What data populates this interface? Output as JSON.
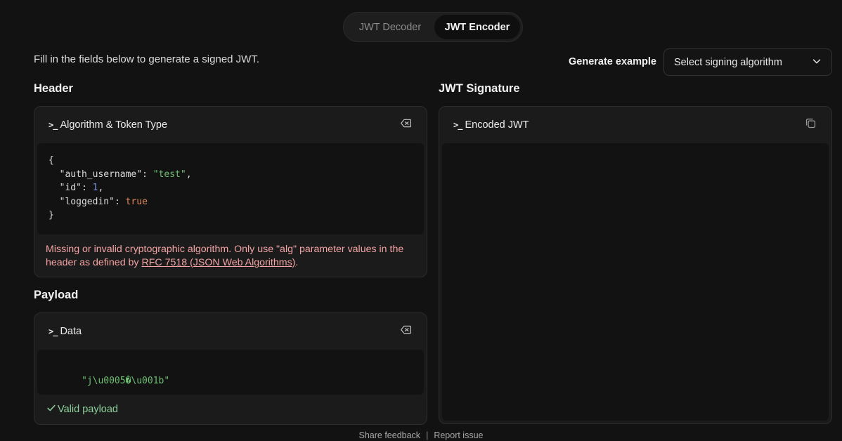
{
  "mode_toggle": {
    "decoder_label": "JWT Decoder",
    "encoder_label": "JWT Encoder",
    "active": "encoder"
  },
  "intro": "Fill in the fields below to generate a signed JWT.",
  "generate": {
    "label": "Generate example",
    "select_value": "Select signing algorithm"
  },
  "header_section": {
    "title": "Header",
    "panel_label": "Algorithm & Token Type",
    "code_lines": [
      {
        "indent": "",
        "key": "{",
        "type": "brace"
      },
      {
        "indent": "  ",
        "key": "\"auth_username\"",
        "value": "\"test\"",
        "vtype": "str",
        "comma": ","
      },
      {
        "indent": "  ",
        "key": "\"id\"",
        "value": "1",
        "vtype": "num",
        "comma": ","
      },
      {
        "indent": "  ",
        "key": "\"loggedin\"",
        "value": "true",
        "vtype": "bool",
        "comma": ""
      },
      {
        "indent": "",
        "key": "}",
        "type": "brace"
      }
    ],
    "error_text": "Missing or invalid cryptographic algorithm. Only use \"alg\" parameter values in the header as defined by ",
    "error_link": "RFC 7518 (JSON Web Algorithms)",
    "error_suffix": "."
  },
  "payload_section": {
    "title": "Payload",
    "panel_label": "Data",
    "code": "\"j\\u0005�\\u001b\"",
    "status": "Valid payload"
  },
  "signature_section": {
    "title": "JWT Signature",
    "panel_label": "Encoded JWT",
    "code": ""
  },
  "footer": {
    "feedback": "Share feedback",
    "separator": "|",
    "report": "Report issue"
  },
  "colors": {
    "background": "#121212",
    "panel": "#1b1b1b",
    "error": "#f4a4a4",
    "valid": "#8fd19e",
    "string": "#6fbf73",
    "number": "#7b8fe0",
    "boolean": "#e08a5a"
  },
  "icons": {
    "panel_prompt": "terminal-prompt-icon",
    "clear": "backspace-icon",
    "copy": "copy-icon",
    "select": "chevron-down-icon",
    "valid": "check-icon"
  }
}
